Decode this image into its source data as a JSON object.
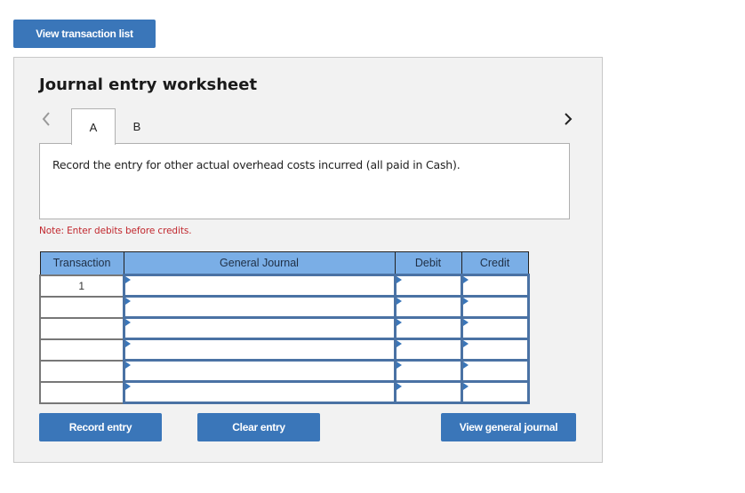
{
  "top_button": {
    "label": "View transaction list"
  },
  "worksheet": {
    "title": "Journal entry worksheet",
    "nav": {
      "prev_icon": "chevron-left-icon",
      "next_icon": "chevron-right-icon"
    },
    "tabs": [
      {
        "label": "A",
        "active": true
      },
      {
        "label": "B",
        "active": false
      }
    ],
    "prompt": "Record the entry for other actual overhead costs incurred (all paid in Cash).",
    "note": "Note: Enter debits before credits.",
    "colors": {
      "accent": "#3a76b9",
      "header_bg": "#7aaee6",
      "note": "#c1272d",
      "panel_bg": "#f2f2f2"
    }
  },
  "table": {
    "headers": [
      "Transaction",
      "General Journal",
      "Debit",
      "Credit"
    ],
    "rows": [
      {
        "transaction": "1",
        "account": "",
        "debit": "",
        "credit": ""
      },
      {
        "transaction": "",
        "account": "",
        "debit": "",
        "credit": ""
      },
      {
        "transaction": "",
        "account": "",
        "debit": "",
        "credit": ""
      },
      {
        "transaction": "",
        "account": "",
        "debit": "",
        "credit": ""
      },
      {
        "transaction": "",
        "account": "",
        "debit": "",
        "credit": ""
      },
      {
        "transaction": "",
        "account": "",
        "debit": "",
        "credit": ""
      }
    ]
  },
  "buttons": {
    "record": "Record entry",
    "clear": "Clear entry",
    "view_journal": "View general journal"
  }
}
